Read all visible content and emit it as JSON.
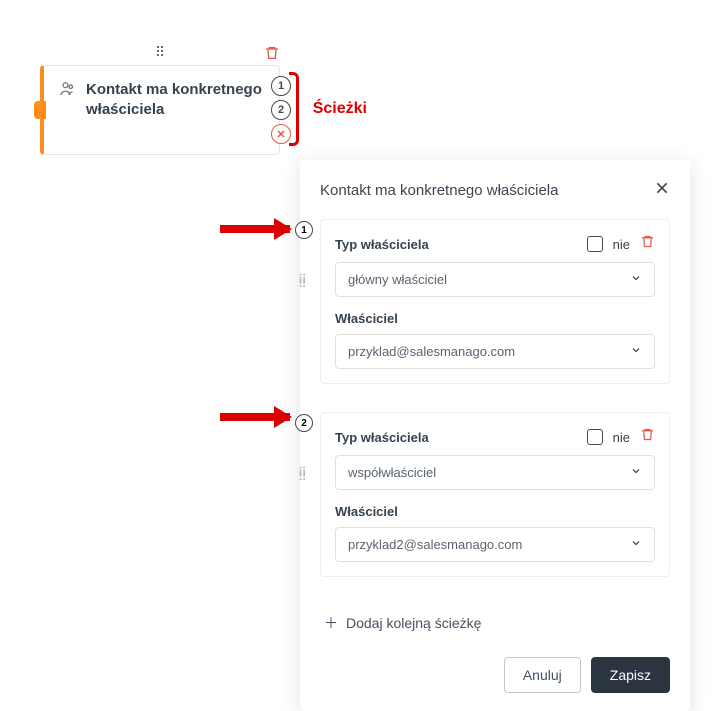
{
  "node": {
    "title": "Kontakt ma konkretnego właściciela",
    "paths_label": "Ścieżki",
    "path_numbers": [
      "1",
      "2"
    ],
    "close_symbol": "✕"
  },
  "panel": {
    "title": "Kontakt ma konkretnego właściciela",
    "paths": [
      {
        "number": "1",
        "type_label": "Typ właściciela",
        "nie_label": "nie",
        "type_value": "główny właściciel",
        "owner_label": "Właściciel",
        "owner_value": "przyklad@salesmanago.com"
      },
      {
        "number": "2",
        "type_label": "Typ właściciela",
        "nie_label": "nie",
        "type_value": "współwłaściciel",
        "owner_label": "Właściciel",
        "owner_value": "przyklad2@salesmanago.com"
      }
    ],
    "add_path_label": "Dodaj kolejną ścieżkę",
    "cancel_label": "Anuluj",
    "save_label": "Zapisz"
  }
}
